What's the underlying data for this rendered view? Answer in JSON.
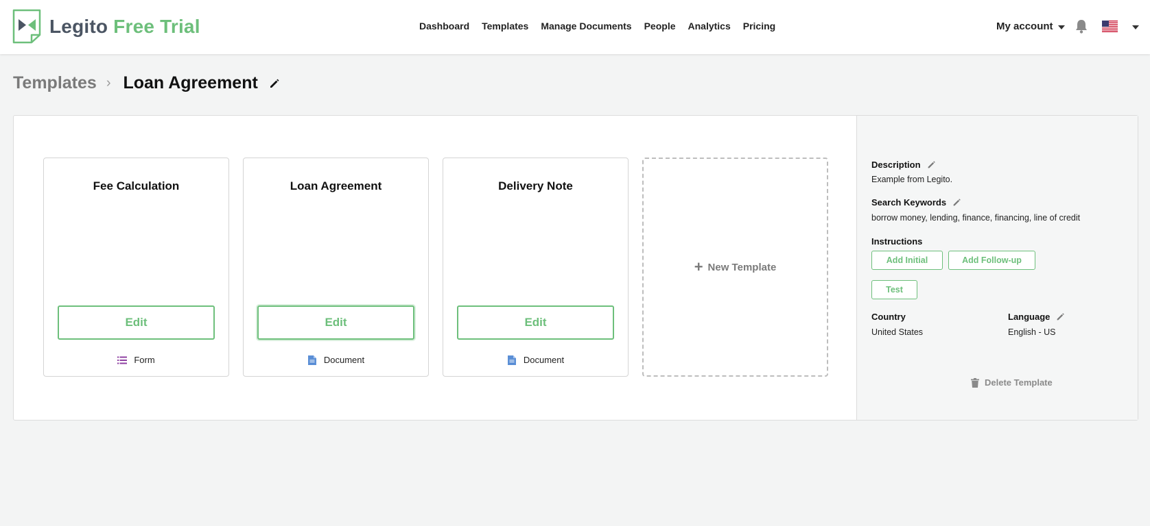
{
  "header": {
    "logo_brand": "Legito",
    "logo_trial": "Free Trial",
    "nav": [
      {
        "label": "Dashboard"
      },
      {
        "label": "Templates"
      },
      {
        "label": "Manage Documents"
      },
      {
        "label": "People"
      },
      {
        "label": "Analytics"
      },
      {
        "label": "Pricing"
      }
    ],
    "account_label": "My account"
  },
  "breadcrumb": {
    "parent": "Templates",
    "separator": "›",
    "current": "Loan Agreement"
  },
  "cards": [
    {
      "title": "Fee Calculation",
      "button": "Edit",
      "type": "Form",
      "type_icon": "form-list-icon"
    },
    {
      "title": "Loan Agreement",
      "button": "Edit",
      "type": "Document",
      "type_icon": "document-icon"
    },
    {
      "title": "Delivery Note",
      "button": "Edit",
      "type": "Document",
      "type_icon": "document-icon"
    }
  ],
  "new_template": {
    "plus": "+",
    "label": "New Template"
  },
  "sidebar": {
    "description_label": "Description",
    "description_value": "Example from Legito.",
    "keywords_label": "Search Keywords",
    "keywords_value": "borrow money, lending, finance, financing, line of credit",
    "instructions_label": "Instructions",
    "add_initial": "Add Initial",
    "add_followup": "Add Follow-up",
    "test": "Test",
    "country_label": "Country",
    "country_value": "United States",
    "language_label": "Language",
    "language_value": "English - US",
    "delete_label": "Delete Template"
  },
  "colors": {
    "accent_green": "#6dbf7b",
    "form_icon": "#8e3fa1",
    "document_icon": "#5b8fd6",
    "page_background": "#f3f4f4"
  }
}
